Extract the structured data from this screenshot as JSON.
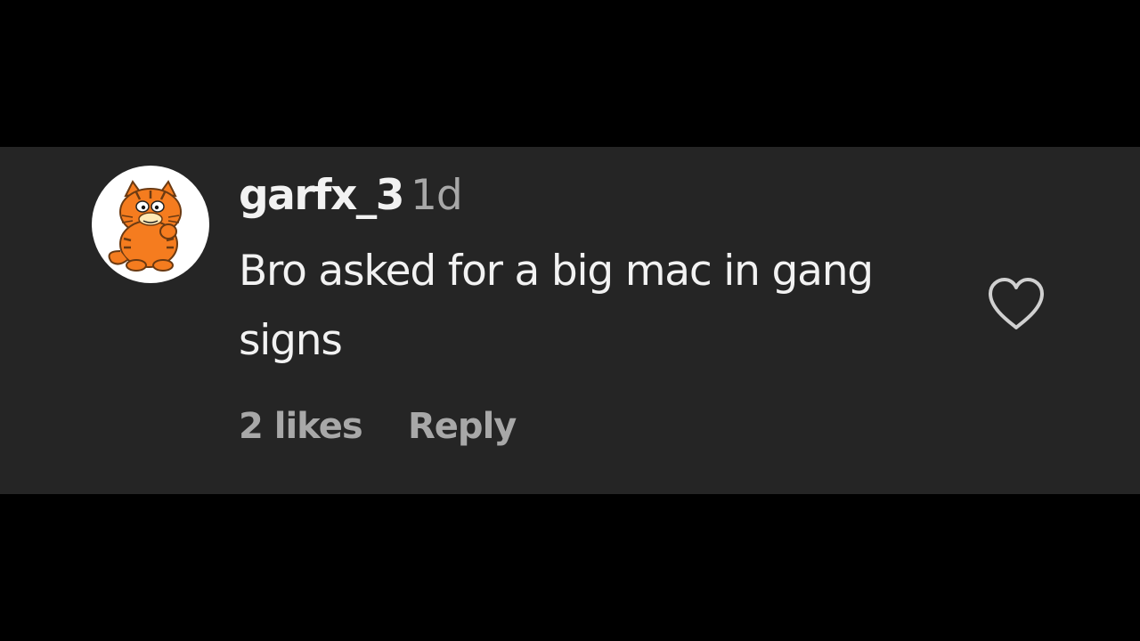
{
  "comment": {
    "username": "garfx_3",
    "timestamp": "1d",
    "text": "Bro asked for a big mac in gang signs",
    "likes": "2 likes",
    "reply_label": "Reply",
    "avatar_icon": "garfield-cat-avatar",
    "like_icon": "heart-outline-icon"
  },
  "colors": {
    "page_background": "#000000",
    "comment_background": "#252525",
    "primary_text": "#f2f2f2",
    "secondary_text": "#a8a8a8",
    "avatar_orange": "#f57c1f"
  }
}
